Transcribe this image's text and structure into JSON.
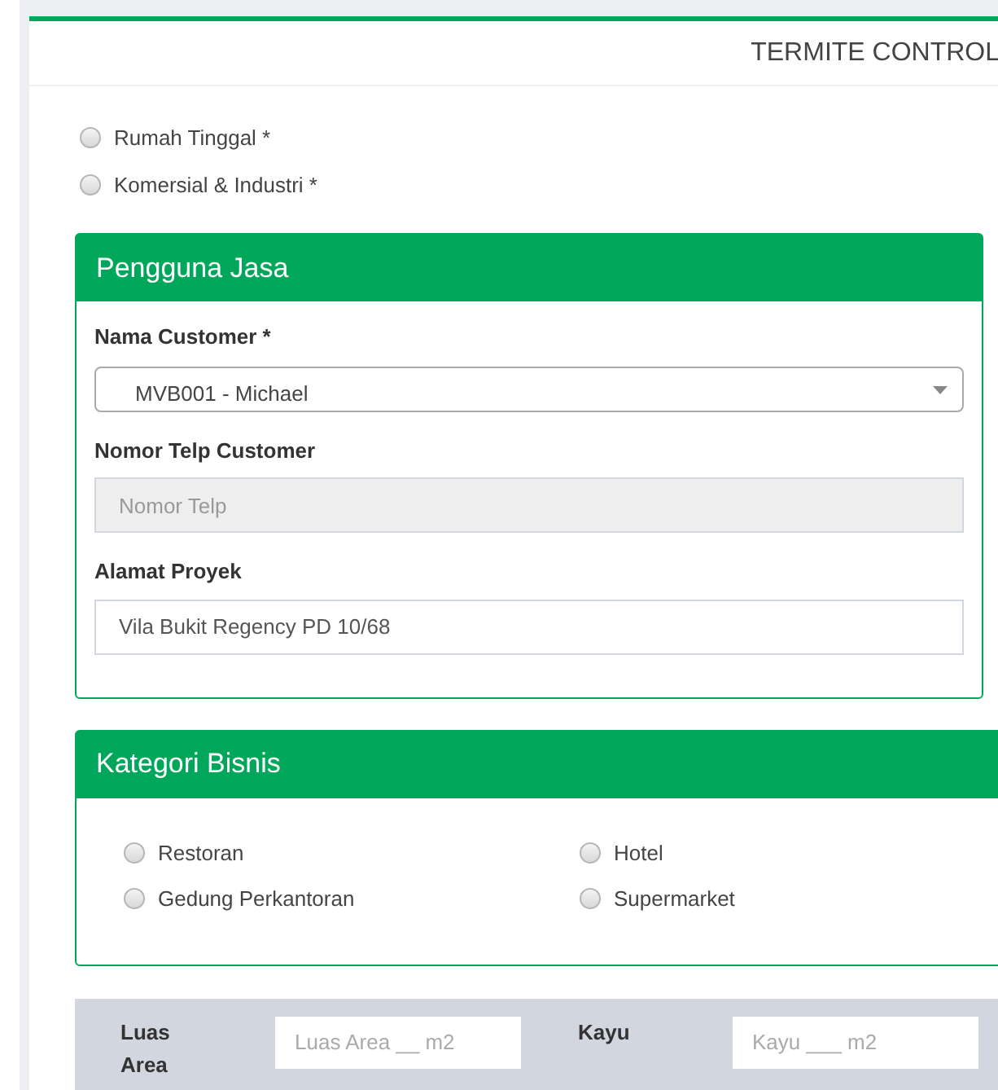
{
  "header": {
    "title": "TERMITE CONTROL"
  },
  "property_types": [
    {
      "label": "Rumah Tinggal *",
      "selected": false
    },
    {
      "label": "Komersial & Industri *",
      "selected": false
    }
  ],
  "pengguna_jasa": {
    "title": "Pengguna Jasa",
    "fields": [
      {
        "kind": "select",
        "label": "Nama Customer *",
        "value": "MVB001 - Michael"
      },
      {
        "kind": "disabled",
        "label": "Nomor Telp Customer",
        "placeholder": "Nomor Telp"
      },
      {
        "kind": "text",
        "label": "Alamat Proyek",
        "value": "Vila Bukit Regency PD 10/68"
      }
    ]
  },
  "kategori_bisnis": {
    "title": "Kategori Bisnis",
    "options": [
      {
        "label": "Restoran",
        "selected": false
      },
      {
        "label": "Hotel",
        "selected": false
      },
      {
        "label": "Gedung Perkantoran",
        "selected": false
      },
      {
        "label": "Supermarket",
        "selected": false
      }
    ]
  },
  "area": [
    {
      "label": "Luas Area",
      "placeholder": "Luas Area __ m2"
    },
    {
      "label": "Kayu",
      "placeholder": "Kayu ___ m2"
    }
  ]
}
